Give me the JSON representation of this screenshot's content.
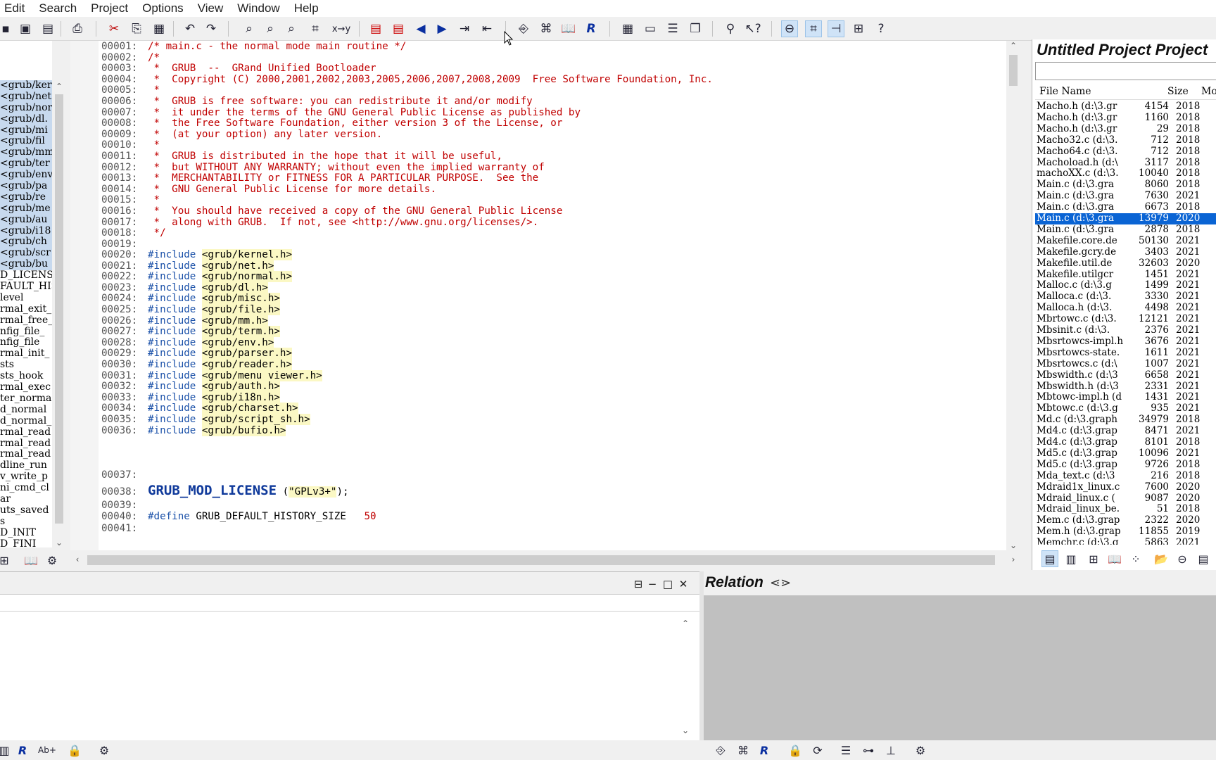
{
  "menu": [
    "Edit",
    "Search",
    "Project",
    "Options",
    "View",
    "Window",
    "Help"
  ],
  "symbols": [
    "<grub/kerr",
    "<grub/net",
    "<grub/nor",
    "<grub/dl.",
    "<grub/mi",
    "<grub/fil",
    "<grub/mm.",
    "<grub/ter",
    "<grub/env",
    "<grub/pa",
    "<grub/re",
    "<grub/me",
    "<grub/au",
    "<grub/i18",
    "<grub/ch",
    "<grub/scr",
    "<grub/bu",
    "D_LICENSE",
    "FAULT_HIST",
    "level",
    "rmal_exit_",
    "rmal_free_",
    "nfig_file_",
    "nfig_file",
    "rmal_init_",
    "sts",
    "sts_hook",
    "rmal_exec",
    "ter_norma",
    "d_normal",
    "d_normal_",
    "rmal_read",
    "rmal_read",
    "rmal_read",
    "dline_run",
    "v_write_p",
    "ni_cmd_cl",
    "ar",
    "uts_saved",
    "s",
    "D_INIT",
    "D_FINI"
  ],
  "editor": {
    "lines": [
      {
        "n": "00001:",
        "t": "/* main.c - the normal mode main routine */"
      },
      {
        "n": "00002:",
        "t": "/*"
      },
      {
        "n": "00003:",
        "t": " *  GRUB  --  GRand Unified Bootloader"
      },
      {
        "n": "00004:",
        "t": " *  Copyright (C) 2000,2001,2002,2003,2005,2006,2007,2008,2009  Free Software Foundation, Inc."
      },
      {
        "n": "00005:",
        "t": " *"
      },
      {
        "n": "00006:",
        "t": " *  GRUB is free software: you can redistribute it and/or modify"
      },
      {
        "n": "00007:",
        "t": " *  it under the terms of the GNU General Public License as published by"
      },
      {
        "n": "00008:",
        "t": " *  the Free Software Foundation, either version 3 of the License, or"
      },
      {
        "n": "00009:",
        "t": " *  (at your option) any later version."
      },
      {
        "n": "00010:",
        "t": " *"
      },
      {
        "n": "00011:",
        "t": " *  GRUB is distributed in the hope that it will be useful,"
      },
      {
        "n": "00012:",
        "t": " *  but WITHOUT ANY WARRANTY; without even the implied warranty of"
      },
      {
        "n": "00013:",
        "t": " *  MERCHANTABILITY or FITNESS FOR A PARTICULAR PURPOSE.  See the"
      },
      {
        "n": "00014:",
        "t": " *  GNU General Public License for more details."
      },
      {
        "n": "00015:",
        "t": " *"
      },
      {
        "n": "00016:",
        "t": " *  You should have received a copy of the GNU General Public License"
      },
      {
        "n": "00017:",
        "t": " *  along with GRUB.  If not, see <http://www.gnu.org/licenses/>."
      },
      {
        "n": "00018:",
        "t": " */"
      },
      {
        "n": "00019:",
        "t": ""
      }
    ],
    "includes": [
      {
        "n": "00020:",
        "d": "#include",
        "h": "<grub/kernel.h>"
      },
      {
        "n": "00021:",
        "d": "#include",
        "h": "<grub/net.h>"
      },
      {
        "n": "00022:",
        "d": "#include",
        "h": "<grub/normal.h>"
      },
      {
        "n": "00023:",
        "d": "#include",
        "h": "<grub/dl.h>"
      },
      {
        "n": "00024:",
        "d": "#include",
        "h": "<grub/misc.h>"
      },
      {
        "n": "00025:",
        "d": "#include",
        "h": "<grub/file.h>"
      },
      {
        "n": "00026:",
        "d": "#include",
        "h": "<grub/mm.h>"
      },
      {
        "n": "00027:",
        "d": "#include",
        "h": "<grub/term.h>"
      },
      {
        "n": "00028:",
        "d": "#include",
        "h": "<grub/env.h>"
      },
      {
        "n": "00029:",
        "d": "#include",
        "h": "<grub/parser.h>"
      },
      {
        "n": "00030:",
        "d": "#include",
        "h": "<grub/reader.h>"
      },
      {
        "n": "00031:",
        "d": "#include",
        "h": "<grub/menu_viewer.h>"
      },
      {
        "n": "00032:",
        "d": "#include",
        "h": "<grub/auth.h>"
      },
      {
        "n": "00033:",
        "d": "#include",
        "h": "<grub/i18n.h>"
      },
      {
        "n": "00034:",
        "d": "#include",
        "h": "<grub/charset.h>"
      },
      {
        "n": "00035:",
        "d": "#include",
        "h": "<grub/script_sh.h>"
      },
      {
        "n": "00036:",
        "d": "#include",
        "h": "<grub/bufio.h>"
      }
    ],
    "l37": "00037:",
    "l38": {
      "n": "00038:",
      "macro": "GRUB_MOD_LICENSE",
      "open": " (",
      "arg": "\"GPLv3+\"",
      "close": ");"
    },
    "l39": "00039:",
    "l40": {
      "n": "00040:",
      "d": "#define",
      "name": "GRUB_DEFAULT_HISTORY_SIZE",
      "val": "50"
    },
    "l41": "00041:"
  },
  "project": {
    "title": "Untitled Project Project",
    "columns": {
      "name": "File Name",
      "size": "Size",
      "mod": "Mod"
    },
    "files": [
      {
        "name": "Macho.h (d:\\3.gr",
        "size": "4154",
        "mod": "2018"
      },
      {
        "name": "Macho.h (d:\\3.gr",
        "size": "1160",
        "mod": "2018"
      },
      {
        "name": "Macho.h (d:\\3.gr",
        "size": "29",
        "mod": "2018"
      },
      {
        "name": "Macho32.c (d:\\3.",
        "size": "712",
        "mod": "2018"
      },
      {
        "name": "Macho64.c (d:\\3.",
        "size": "712",
        "mod": "2018"
      },
      {
        "name": "Machoload.h (d:\\",
        "size": "3117",
        "mod": "2018"
      },
      {
        "name": "machoXX.c (d:\\3.",
        "size": "10040",
        "mod": "2018"
      },
      {
        "name": "Main.c (d:\\3.gra",
        "size": "8060",
        "mod": "2018"
      },
      {
        "name": "Main.c (d:\\3.gra",
        "size": "7630",
        "mod": "2021"
      },
      {
        "name": "Main.c (d:\\3.gra",
        "size": "6673",
        "mod": "2018"
      },
      {
        "name": "Main.c (d:\\3.gra",
        "size": "13979",
        "mod": "2020",
        "sel": true
      },
      {
        "name": "Main.c (d:\\3.gra",
        "size": "2878",
        "mod": "2018"
      },
      {
        "name": "Makefile.core.de",
        "size": "50130",
        "mod": "2021"
      },
      {
        "name": "Makefile.gcry.de",
        "size": "3403",
        "mod": "2021"
      },
      {
        "name": "Makefile.util.de",
        "size": "32603",
        "mod": "2020"
      },
      {
        "name": "Makefile.utilgcr",
        "size": "1451",
        "mod": "2021"
      },
      {
        "name": "Malloc.c (d:\\3.g",
        "size": "1499",
        "mod": "2021"
      },
      {
        "name": "Malloca.c (d:\\3.",
        "size": "3330",
        "mod": "2021"
      },
      {
        "name": "Malloca.h (d:\\3.",
        "size": "4498",
        "mod": "2021"
      },
      {
        "name": "Mbrtowc.c (d:\\3.",
        "size": "12121",
        "mod": "2021"
      },
      {
        "name": "Mbsinit.c (d:\\3.",
        "size": "2376",
        "mod": "2021"
      },
      {
        "name": "Mbsrtowcs-impl.h",
        "size": "3676",
        "mod": "2021"
      },
      {
        "name": "Mbsrtowcs-state.",
        "size": "1611",
        "mod": "2021"
      },
      {
        "name": "Mbsrtowcs.c (d:\\",
        "size": "1007",
        "mod": "2021"
      },
      {
        "name": "Mbswidth.c (d:\\3",
        "size": "6658",
        "mod": "2021"
      },
      {
        "name": "Mbswidth.h (d:\\3",
        "size": "2331",
        "mod": "2021"
      },
      {
        "name": "Mbtowc-impl.h (d",
        "size": "1431",
        "mod": "2021"
      },
      {
        "name": "Mbtowc.c (d:\\3.g",
        "size": "935",
        "mod": "2021"
      },
      {
        "name": "Md.c (d:\\3.graph",
        "size": "34979",
        "mod": "2018"
      },
      {
        "name": "Md4.c (d:\\3.grap",
        "size": "8471",
        "mod": "2021"
      },
      {
        "name": "Md4.c (d:\\3.grap",
        "size": "8101",
        "mod": "2018"
      },
      {
        "name": "Md5.c (d:\\3.grap",
        "size": "10096",
        "mod": "2021"
      },
      {
        "name": "Md5.c (d:\\3.grap",
        "size": "9726",
        "mod": "2018"
      },
      {
        "name": "Mda_text.c (d:\\3",
        "size": "216",
        "mod": "2018"
      },
      {
        "name": "Mdraid1x_linux.c",
        "size": "7600",
        "mod": "2020"
      },
      {
        "name": "Mdraid_linux.c (",
        "size": "9087",
        "mod": "2020"
      },
      {
        "name": "Mdraid_linux_be.",
        "size": "51",
        "mod": "2018"
      },
      {
        "name": "Mem.c (d:\\3.grap",
        "size": "2322",
        "mod": "2020"
      },
      {
        "name": "Mem.h (d:\\3.grap",
        "size": "11855",
        "mod": "2019"
      },
      {
        "name": "Memchr.c (d:\\3.g",
        "size": "5863",
        "mod": "2021"
      }
    ]
  },
  "relation": {
    "title": "Relation"
  },
  "icons": {
    "new": "▣",
    "save": "💾",
    "print": "🖶",
    "cut": "✂",
    "copy": "⎘",
    "paste": "📋",
    "undo": "↶",
    "redo": "↷",
    "find": "🔍",
    "replace": "x↔y",
    "back": "◀",
    "forward": "▶",
    "help": "?"
  }
}
